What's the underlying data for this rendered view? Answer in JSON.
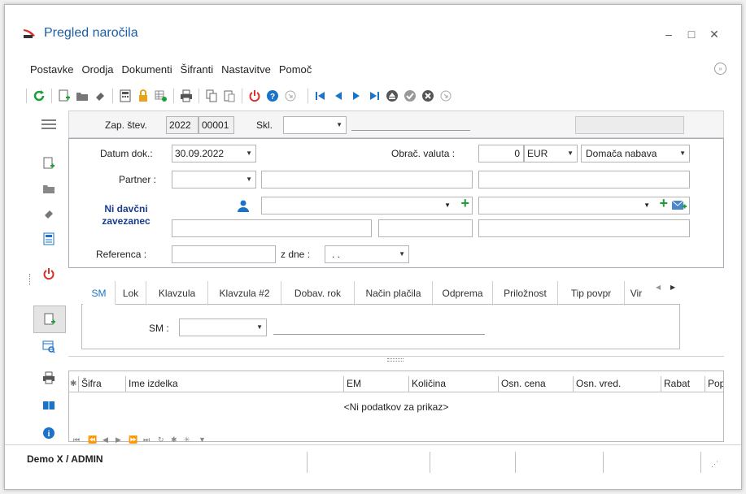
{
  "window": {
    "title": "Pregled naročila"
  },
  "menu": [
    "Postavke",
    "Orodja",
    "Dokumenti",
    "Šifranti",
    "Nastavitve",
    "Pomoč"
  ],
  "header": {
    "zap_label": "Zap. štev.",
    "zap_year": "2022",
    "zap_num": "00001",
    "skl_label": "Skl."
  },
  "form": {
    "datum_label": "Datum dok.:",
    "datum_value": "30.09.2022",
    "obrac_label": "Obrač. valuta :",
    "obrac_value": "0",
    "currency": "EUR",
    "nabava": "Domača nabava",
    "partner_label": "Partner :",
    "ni_davcni": "Ni davčni zavezanec",
    "referenca_label": "Referenca :",
    "z_dne_label": "z dne :",
    "z_dne_value": ". ."
  },
  "tabs": [
    "SM",
    "Lok",
    "Klavzula",
    "Klavzula #2",
    "Dobav. rok",
    "Način plačila",
    "Odprema",
    "Priložnost",
    "Tip povpr",
    "Vir"
  ],
  "sm_panel": {
    "label": "SM :"
  },
  "grid": {
    "columns": [
      "Šifra",
      "Ime izdelka",
      "EM",
      "Količina",
      "Osn. cena",
      "Osn. vred.",
      "Rabat",
      "Pop"
    ],
    "empty_text": "<Ni podatkov za prikaz>"
  },
  "status": {
    "user": "Demo X / ADMIN"
  },
  "colors": {
    "accent": "#1a73c8",
    "title": "#1a5fa8",
    "power": "#d9302c",
    "green": "#1e9e3a"
  }
}
